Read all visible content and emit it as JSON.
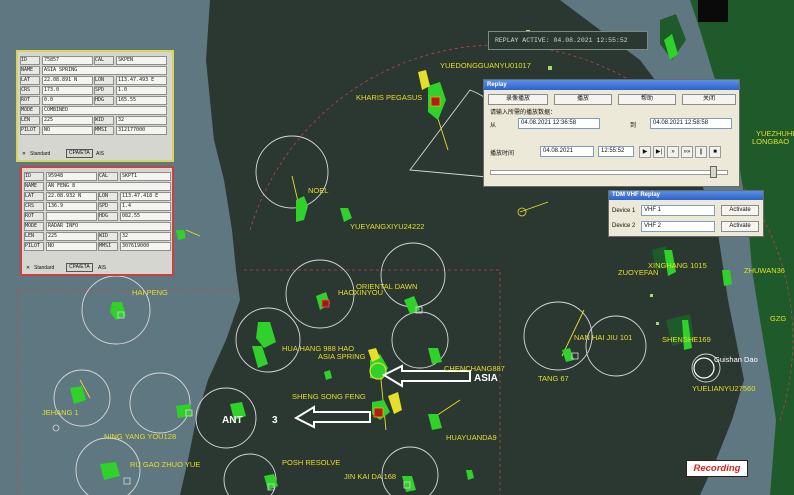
{
  "banner": {
    "text": "REPLAY ACTIVE:  04.08.2021 12:55:52"
  },
  "recording": {
    "text": "Recording"
  },
  "ships": [
    {
      "name": "NOEL"
    },
    {
      "name": "HAI PENG"
    },
    {
      "name": "HAOXINYOU"
    },
    {
      "name": "ORIENTAL DAWN"
    },
    {
      "name": "HUA HANG 988 HAO"
    },
    {
      "name": "ASIA SPRING"
    },
    {
      "name": "CHENCHANG887"
    },
    {
      "name": "NAN HAI JIU 101"
    },
    {
      "name": "TANG 67"
    },
    {
      "name": "SHENG SONG FENG"
    },
    {
      "name": "JEHANG 1"
    },
    {
      "name": "NING YANG YOU128"
    },
    {
      "name": "RU GAO ZHUO YUE"
    },
    {
      "name": "POSH RESOLVE"
    },
    {
      "name": "JIN KAI DA 168"
    },
    {
      "name": "HUAYUANDA9"
    },
    {
      "name": "YUEYANGXIYU24222"
    },
    {
      "name": "KHARIS PEGASUS"
    },
    {
      "name": "YUEDONGGUANYU01017"
    },
    {
      "name": "YUEZHUHE"
    },
    {
      "name": "LONGBAO"
    },
    {
      "name": "ZUOYEFAN"
    },
    {
      "name": "XINGHANG 1015"
    },
    {
      "name": "ZHUWAN36"
    },
    {
      "name": "SHENSHE169"
    },
    {
      "name": "GZG"
    },
    {
      "name": "YUELIANYU27560"
    },
    {
      "name": "Guishan Dao"
    }
  ],
  "annotations": {
    "asia": "ASIA",
    "ant": "ANT",
    "three": "3"
  },
  "panel1": {
    "rows": [
      {
        "k": "ID",
        "v1": "75857",
        "k2": "CAL",
        "v2": "SKPEN"
      },
      {
        "k": "NAME",
        "v1": "ASIA SPRING",
        "k2": "",
        "v2": ""
      },
      {
        "k": "LAT",
        "v1": "22.08.891 N",
        "k2": "LON",
        "v2": "113.47.493 E"
      },
      {
        "k": "CRS",
        "v1": "173.0",
        "k2": "SPD",
        "v2": "1.0"
      },
      {
        "k": "ROT",
        "v1": "0.0",
        "k2": "HDG",
        "v2": "165.55"
      },
      {
        "k": "MODE",
        "v1": "COMBINED",
        "k2": "",
        "v2": ""
      },
      {
        "k": "LEN",
        "v1": "225",
        "k2": "WID",
        "v2": "32"
      },
      {
        "k": "PILOT",
        "v1": "NO",
        "k2": "MMSI",
        "v2": "312177000"
      }
    ],
    "tabs": [
      "Standard",
      "CPA/ETA",
      "AIS"
    ]
  },
  "panel2": {
    "rows": [
      {
        "k": "ID",
        "v1": "95948",
        "k2": "CAL",
        "v2": "SKPT1"
      },
      {
        "k": "NAME",
        "v1": "AN FENG 8",
        "k2": "",
        "v2": ""
      },
      {
        "k": "LAT",
        "v1": "22.08.932 N",
        "k2": "LON",
        "v2": "113.47.418 E"
      },
      {
        "k": "CRS",
        "v1": "136.9",
        "k2": "SPD",
        "v2": "1.4"
      },
      {
        "k": "ROT",
        "v1": "",
        "k2": "HDG",
        "v2": "082.55"
      },
      {
        "k": "MODE",
        "v1": "RADAR INFO",
        "k2": "",
        "v2": ""
      },
      {
        "k": "LEN",
        "v1": "225",
        "k2": "WID",
        "v2": "32"
      },
      {
        "k": "PILOT",
        "v1": "NO",
        "k2": "MMSI",
        "v2": "307619000"
      }
    ],
    "tabs": [
      "Standard",
      "CPA/ETA",
      "AIS"
    ]
  },
  "replay": {
    "title": "Replay",
    "btn1": "录像播放",
    "btn2": "播放",
    "btn3": "帮助",
    "btn4": "关闭",
    "hint": "请输入所需的播放数据：",
    "from_label": "从",
    "from": "04.08.2021 12:36:58",
    "to_label": "到",
    "to": "04.08.2021 12:58:58",
    "time_label": "播放时间",
    "date": "04.08.2021",
    "time": "12:55:52"
  },
  "vhf": {
    "title": "TDM VHF Replay",
    "d1_label": "Device 1",
    "d1": "VHF 1",
    "d2_label": "Device 2",
    "d2": "VHF 2",
    "activate": "Activate"
  },
  "colors": {
    "water": "#2b3731",
    "shallow": "#5f7780",
    "land": "#1f5a2b",
    "label": "#e6df2a",
    "ship": "#2fd12a",
    "circle": "#d8d8d8",
    "track": "#e6df2a",
    "recording": "#d22424"
  }
}
